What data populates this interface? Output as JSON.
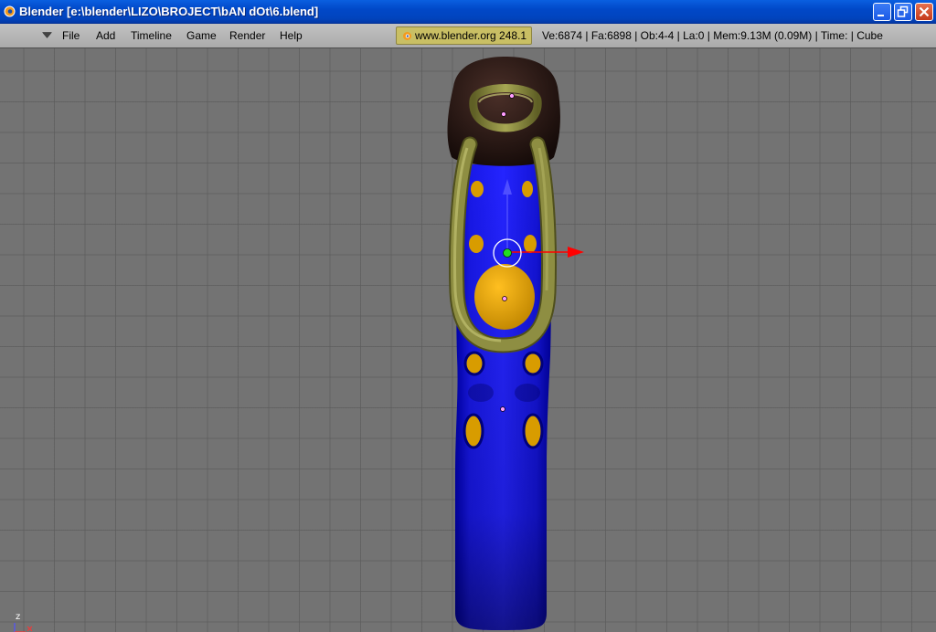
{
  "window": {
    "title": "Blender [e:\\blender\\LIZO\\BROJECT\\bAN dOt\\6.blend]",
    "minimize_label": "minimize",
    "maximize_label": "restore",
    "close_label": "close"
  },
  "menu": {
    "items": [
      "File",
      "Add",
      "Timeline",
      "Game",
      "Render",
      "Help"
    ]
  },
  "header": {
    "web_link": "www.blender.org 248.1",
    "stats": "Ve:6874 | Fa:6898 | Ob:4-4 | La:0  | Mem:9.13M (0.09M)  | Time: | Cube"
  },
  "viewport": {
    "axis_label": "z"
  },
  "colors": {
    "title_bar": "#0148c8",
    "menu_bar": "#b5b5b5",
    "viewport_bg": "#737373",
    "model_blue": "#1414e0",
    "model_gold": "#e0a500",
    "handle_olive": "#8a8a3c",
    "head_dark": "#2a1a16",
    "gizmo_red": "#ff0000",
    "gizmo_blue": "#4a4aff"
  },
  "icons": {
    "app": "blender-logo-icon",
    "menu": "chevron-down-icon",
    "minimize": "minimize-icon",
    "maximize": "maximize-icon",
    "close": "close-icon"
  }
}
